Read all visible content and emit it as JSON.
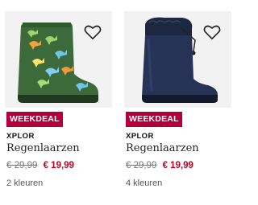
{
  "products": [
    {
      "badge": "WEEKDEAL",
      "brand": "XPLOR",
      "name": "Regenlaarzen",
      "old_price": "€ 29,99",
      "new_price": "€ 19,99",
      "colors": "2 kleuren",
      "image": "green-dino-rain-boot",
      "badge_color": "#b3003b",
      "price_color": "#c4001d"
    },
    {
      "badge": "WEEKDEAL",
      "brand": "XPLOR",
      "name": "Regenlaarzen",
      "old_price": "€ 29,99",
      "new_price": "€ 19,99",
      "colors": "4 kleuren",
      "image": "navy-lined-rain-boot",
      "badge_color": "#b3003b",
      "price_color": "#c4001d"
    }
  ],
  "icons": {
    "wishlist": "heart-outline-icon"
  }
}
